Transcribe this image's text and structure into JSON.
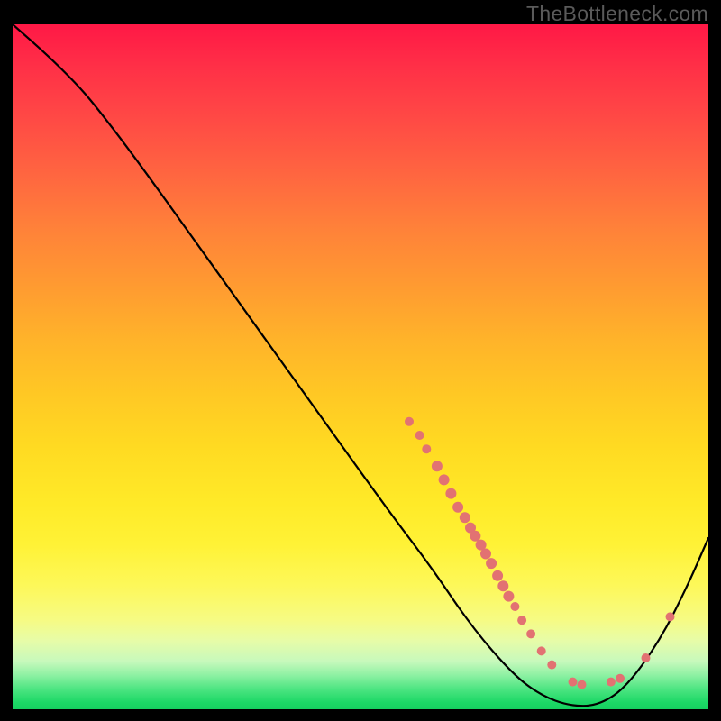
{
  "watermark": "TheBottleneck.com",
  "chart_data": {
    "type": "line",
    "title": "",
    "xlabel": "",
    "ylabel": "",
    "xlim": [
      0,
      100
    ],
    "ylim": [
      0,
      100
    ],
    "curve": [
      {
        "x": 0,
        "y": 100
      },
      {
        "x": 5,
        "y": 95.5
      },
      {
        "x": 9,
        "y": 91.5
      },
      {
        "x": 12,
        "y": 88
      },
      {
        "x": 18,
        "y": 80
      },
      {
        "x": 30,
        "y": 63
      },
      {
        "x": 42,
        "y": 46
      },
      {
        "x": 54,
        "y": 29
      },
      {
        "x": 60,
        "y": 21
      },
      {
        "x": 66,
        "y": 12
      },
      {
        "x": 72,
        "y": 5
      },
      {
        "x": 76,
        "y": 2
      },
      {
        "x": 80,
        "y": 0.5
      },
      {
        "x": 84,
        "y": 0.5
      },
      {
        "x": 88,
        "y": 3
      },
      {
        "x": 93,
        "y": 10
      },
      {
        "x": 97,
        "y": 18
      },
      {
        "x": 100,
        "y": 25
      }
    ],
    "markers": [
      {
        "x": 57,
        "y": 42,
        "r": 5
      },
      {
        "x": 58.5,
        "y": 40,
        "r": 5
      },
      {
        "x": 59.5,
        "y": 38,
        "r": 5
      },
      {
        "x": 61,
        "y": 35.5,
        "r": 6
      },
      {
        "x": 62,
        "y": 33.5,
        "r": 6
      },
      {
        "x": 63,
        "y": 31.5,
        "r": 6
      },
      {
        "x": 64,
        "y": 29.5,
        "r": 6
      },
      {
        "x": 65,
        "y": 28,
        "r": 6
      },
      {
        "x": 65.8,
        "y": 26.5,
        "r": 6
      },
      {
        "x": 66.5,
        "y": 25.3,
        "r": 6
      },
      {
        "x": 67.3,
        "y": 24,
        "r": 6
      },
      {
        "x": 68,
        "y": 22.7,
        "r": 6
      },
      {
        "x": 68.8,
        "y": 21.3,
        "r": 6
      },
      {
        "x": 69.7,
        "y": 19.5,
        "r": 6
      },
      {
        "x": 70.5,
        "y": 18,
        "r": 6
      },
      {
        "x": 71.3,
        "y": 16.5,
        "r": 6
      },
      {
        "x": 72.2,
        "y": 15,
        "r": 5
      },
      {
        "x": 73.2,
        "y": 13,
        "r": 5
      },
      {
        "x": 74.5,
        "y": 11,
        "r": 5
      },
      {
        "x": 76,
        "y": 8.5,
        "r": 5
      },
      {
        "x": 77.5,
        "y": 6.5,
        "r": 5
      },
      {
        "x": 80.5,
        "y": 4,
        "r": 5
      },
      {
        "x": 81.8,
        "y": 3.6,
        "r": 5
      },
      {
        "x": 86,
        "y": 4,
        "r": 5
      },
      {
        "x": 87.3,
        "y": 4.5,
        "r": 5
      },
      {
        "x": 91,
        "y": 7.5,
        "r": 5
      },
      {
        "x": 94.5,
        "y": 13.5,
        "r": 5
      }
    ]
  }
}
